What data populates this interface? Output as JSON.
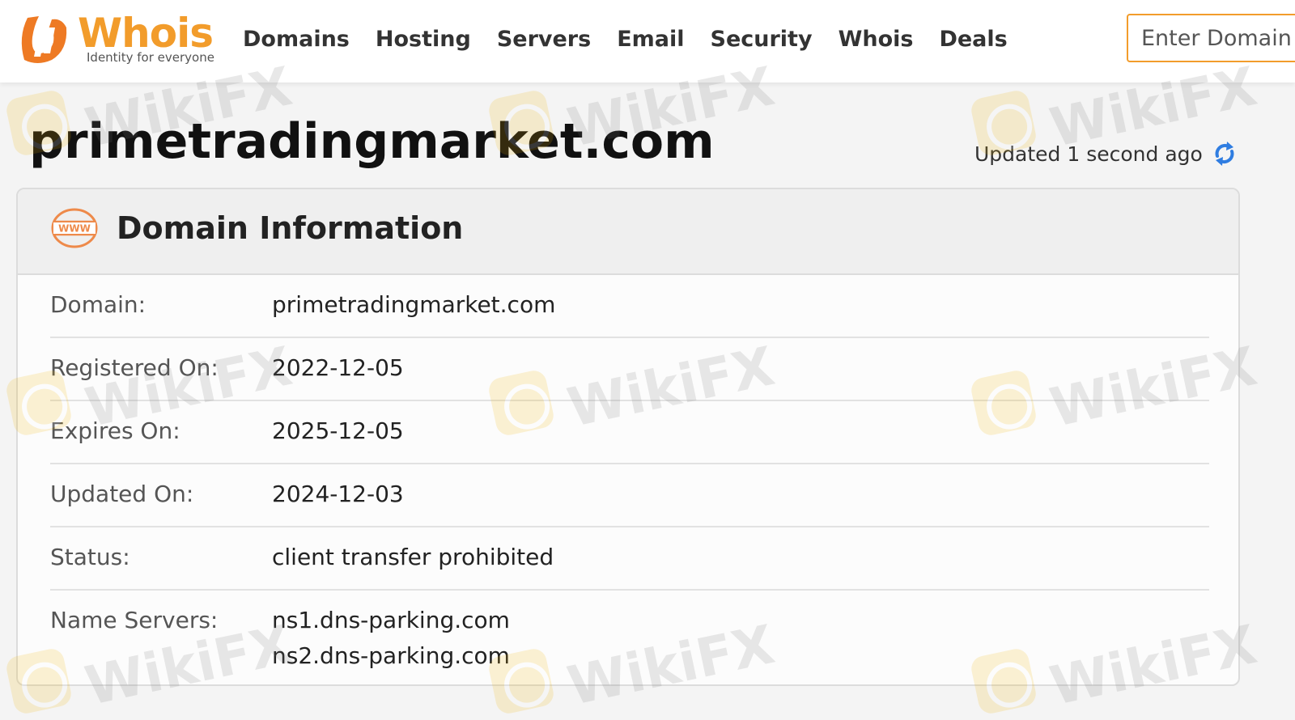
{
  "header": {
    "logo_word": "Whois",
    "logo_tagline": "Identity for everyone",
    "nav": [
      "Domains",
      "Hosting",
      "Servers",
      "Email",
      "Security",
      "Whois",
      "Deals"
    ],
    "search_placeholder": "Enter Domain"
  },
  "page": {
    "title": "primetradingmarket.com",
    "updated_text": "Updated 1 second ago"
  },
  "card": {
    "title": "Domain Information",
    "icon": "www-icon",
    "rows": [
      {
        "label": "Domain:",
        "values": [
          "primetradingmarket.com"
        ]
      },
      {
        "label": "Registered On:",
        "values": [
          "2022-12-05"
        ]
      },
      {
        "label": "Expires On:",
        "values": [
          "2025-12-05"
        ]
      },
      {
        "label": "Updated On:",
        "values": [
          "2024-12-03"
        ]
      },
      {
        "label": "Status:",
        "values": [
          "client transfer prohibited"
        ]
      },
      {
        "label": "Name Servers:",
        "values": [
          "ns1.dns-parking.com",
          "ns2.dns-parking.com"
        ]
      }
    ]
  },
  "watermark": {
    "text": "WikiFX"
  },
  "colors": {
    "brand_orange": "#f29c2b",
    "refresh_blue": "#2f7de1",
    "header_bg": "#ffffff",
    "card_head_bg": "#efefef"
  }
}
